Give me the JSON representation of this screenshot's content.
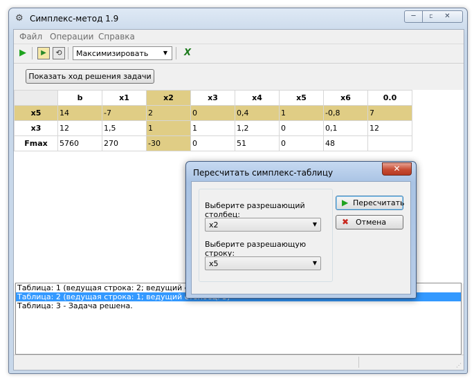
{
  "window": {
    "title": "Симплекс-метод 1.9",
    "buttons": {
      "minimize": "─",
      "maximize": "▫",
      "close": "✕"
    }
  },
  "menu": {
    "items": [
      "Файл",
      "Операции",
      "Справка"
    ]
  },
  "toolbar": {
    "run_icon": "▶",
    "step_icon": "▶",
    "reset_icon": "⟲",
    "mode_value": "Максимизировать",
    "excel_icon": "X"
  },
  "actions": {
    "show_solution_label": "Показать ход решения задачи"
  },
  "table": {
    "headers": [
      "",
      "b",
      "x1",
      "x2",
      "x3",
      "x4",
      "x5",
      "x6",
      "0.0"
    ],
    "rows": [
      [
        "x5",
        "14",
        "-7",
        "2",
        "0",
        "0,4",
        "1",
        "-0,8",
        "7"
      ],
      [
        "x3",
        "12",
        "1,5",
        "1",
        "1",
        "1,2",
        "0",
        "0,1",
        "12"
      ],
      [
        "Fmax",
        "5760",
        "270",
        "-30",
        "0",
        "51",
        "0",
        "48",
        ""
      ]
    ],
    "highlight_color": "#e0cd85"
  },
  "log": {
    "lines": [
      "Таблица: 1 (ведущая строка: 2; ведущий столбец: 5)",
      "Таблица: 2 (ведущая строка: 1; ведущий столбец: 3)",
      "Таблица: 3 - Задача решена."
    ],
    "selected_index": 1
  },
  "dialog": {
    "title": "Пересчитать симплекс-таблицу",
    "close_label": "✕",
    "column_label": "Выберите разрешающий столбец:",
    "column_value": "x2",
    "row_label": "Выберите разрешающую строку:",
    "row_value": "x5",
    "recalc_label": "Пересчитать",
    "cancel_label": "Отмена"
  }
}
